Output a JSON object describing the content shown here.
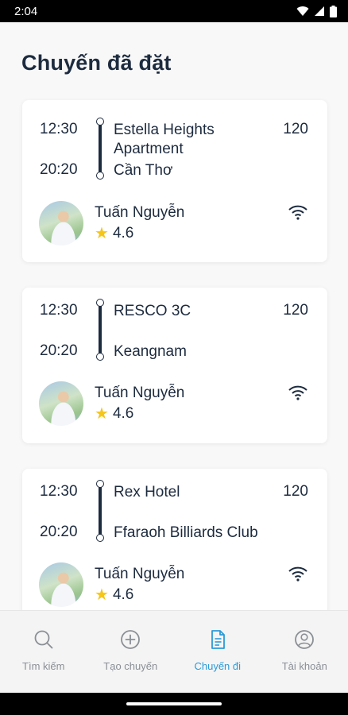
{
  "status": {
    "time": "2:04"
  },
  "page": {
    "title": "Chuyến đã đặt"
  },
  "trips": [
    {
      "depart_time": "12:30",
      "arrive_time": "20:20",
      "origin": "Estella Heights Apartment",
      "destination": "Cần Thơ",
      "price": "120",
      "driver": {
        "name": "Tuấn Nguyễn",
        "rating": "4.6"
      }
    },
    {
      "depart_time": "12:30",
      "arrive_time": "20:20",
      "origin": "RESCO 3C",
      "destination": "Keangnam",
      "price": "120",
      "driver": {
        "name": "Tuấn Nguyễn",
        "rating": "4.6"
      }
    },
    {
      "depart_time": "12:30",
      "arrive_time": "20:20",
      "origin": "Rex Hotel",
      "destination": "Ffaraoh Billiards Club",
      "price": "120",
      "driver": {
        "name": "Tuấn Nguyễn",
        "rating": "4.6"
      }
    }
  ],
  "nav": {
    "items": [
      {
        "label": "Tìm kiếm",
        "icon": "search-icon"
      },
      {
        "label": "Tạo chuyến",
        "icon": "plus-circle-icon"
      },
      {
        "label": "Chuyến đi",
        "icon": "document-icon",
        "active": true
      },
      {
        "label": "Tài khoản",
        "icon": "account-icon"
      }
    ]
  },
  "colors": {
    "text": "#1d2b3f",
    "accent": "#2a9bd8",
    "star": "#f5c518"
  }
}
